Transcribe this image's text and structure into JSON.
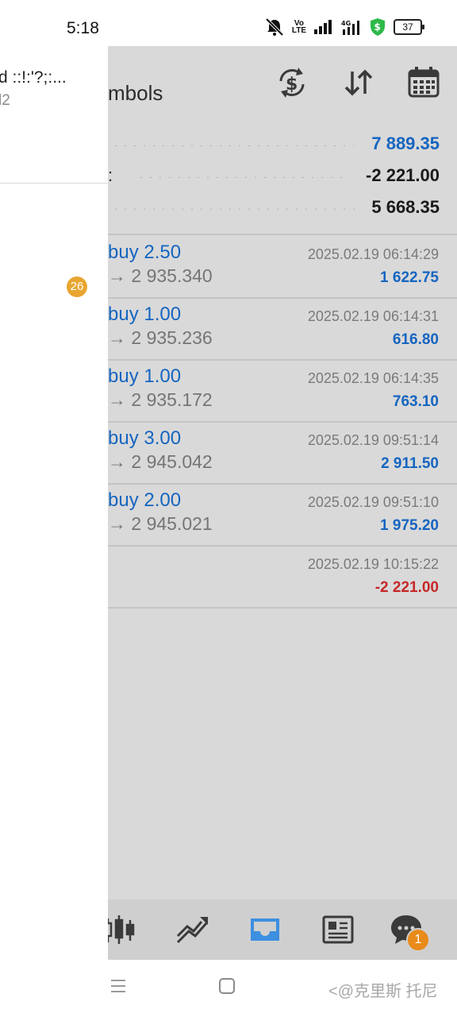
{
  "status_bar": {
    "time": "5:18",
    "volte_label": "Vo\nLTE",
    "net_label": "4G",
    "battery": "37"
  },
  "drawer": {
    "title": "d ::!:'?;:...",
    "subtitle": "l2",
    "badge_count": "26"
  },
  "header": {
    "title": "mbols",
    "icons": [
      "currency-exchange-icon",
      "sort-icon",
      "calendar-icon"
    ]
  },
  "summary": [
    {
      "label": "",
      "value": "7 889.35",
      "color": "#1565c0"
    },
    {
      "label": ":",
      "value": "-2 221.00",
      "color": "#1a1a1a"
    },
    {
      "label": "",
      "value": "5 668.35",
      "color": "#1a1a1a"
    }
  ],
  "trades": [
    {
      "type": "buy 2.50",
      "price": "→ 2 935.340",
      "time": "2025.02.19 06:14:29",
      "profit": "1 622.75"
    },
    {
      "type": "buy 1.00",
      "price": "→ 2 935.236",
      "time": "2025.02.19 06:14:31",
      "profit": "616.80"
    },
    {
      "type": "buy 1.00",
      "price": "→ 2 935.172",
      "time": "2025.02.19 06:14:35",
      "profit": "763.10"
    },
    {
      "type": "buy 3.00",
      "price": "→ 2 945.042",
      "time": "2025.02.19 09:51:14",
      "profit": "2 911.50"
    },
    {
      "type": "buy 2.00",
      "price": "→ 2 945.021",
      "time": "2025.02.19 09:51:10",
      "profit": "1 975.20"
    },
    {
      "type": "",
      "price": "",
      "time": "2025.02.19 10:15:22",
      "profit": "-2 221.00"
    }
  ],
  "colors": {
    "accent_blue": "#1565c0",
    "negative_red": "#c62828",
    "active_tab": "#3d8fe0",
    "badge_orange": "#e88b1a"
  },
  "tabbar": {
    "tabs": [
      "quotes-candles-icon",
      "chart-trend-icon",
      "trade-inbox-icon",
      "news-icon",
      "chat-icon"
    ],
    "active_tab": "trade-inbox-icon",
    "chat_badge": "1"
  },
  "watermark": "@克里斯 托尼"
}
